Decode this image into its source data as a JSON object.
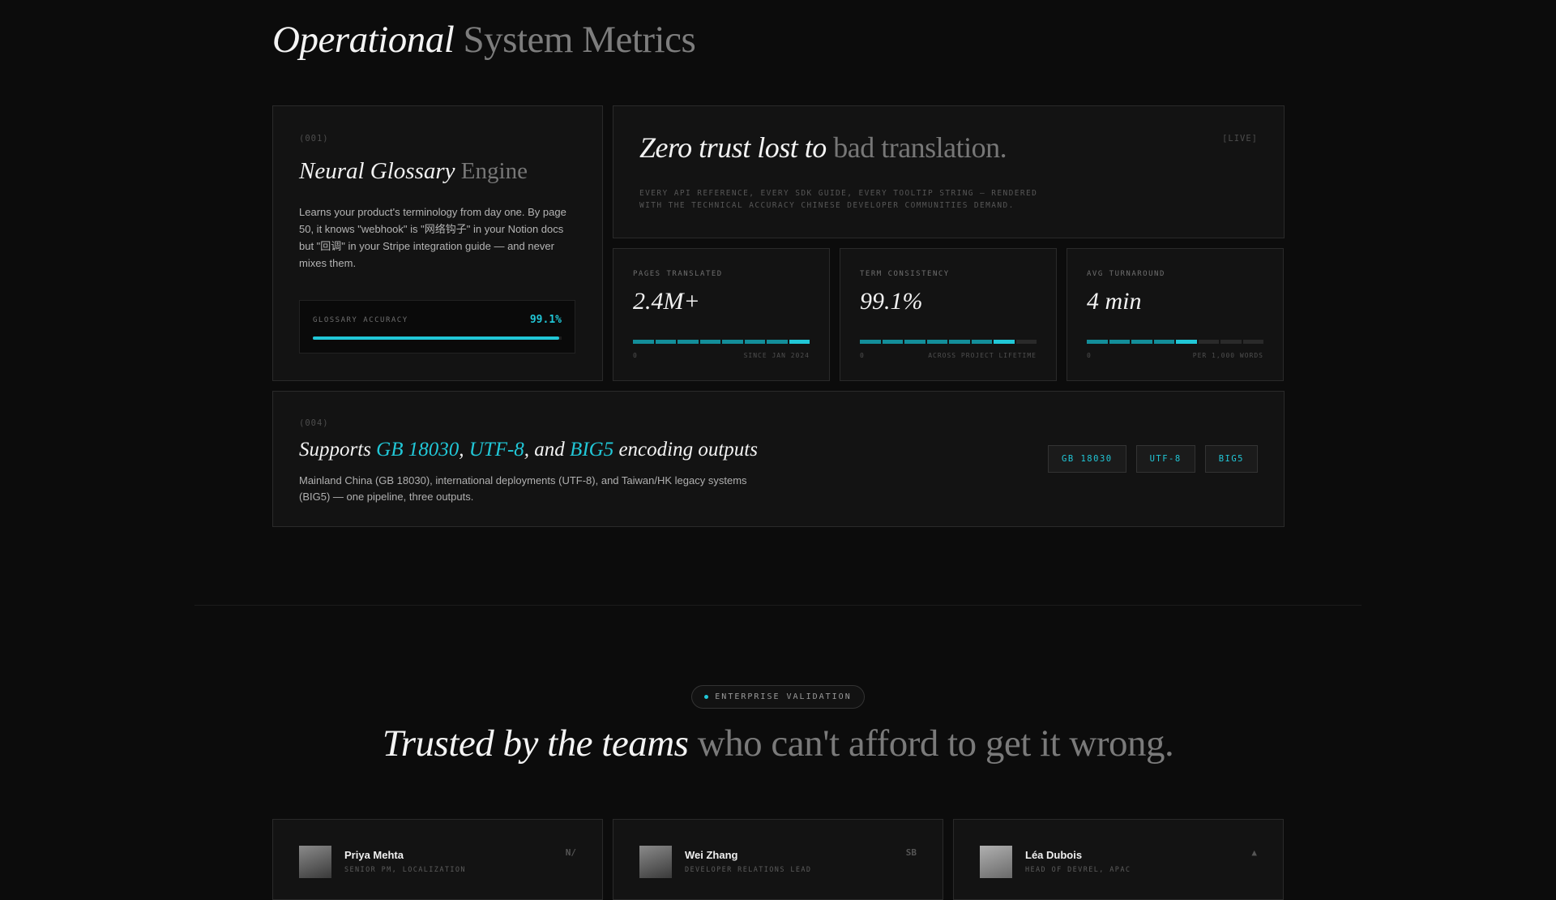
{
  "header": {
    "title_em": "Operational",
    "title_rest": "System Metrics"
  },
  "glossary": {
    "index": "(001)",
    "title_em": "Neural Glossary",
    "title_rest": "Engine",
    "description": "Learns your product's terminology from day one. By page 50, it knows \"webhook\" is \"网络钩子\" in your Notion docs but \"回调\" in your Stripe integration guide — and never mixes them.",
    "accuracy_label": "GLOSSARY ACCURACY",
    "accuracy_value": "99.1%",
    "accuracy_fraction": 0.991
  },
  "hero": {
    "title_em": "Zero trust lost to",
    "title_rest": "bad translation.",
    "live_tag": "[LIVE]",
    "subtitle": "EVERY API REFERENCE, EVERY SDK GUIDE, EVERY TOOLTIP STRING — RENDERED WITH THE TECHNICAL ACCURACY CHINESE DEVELOPER COMMUNITIES DEMAND."
  },
  "stats": [
    {
      "label": "PAGES TRANSLATED",
      "value": "2.4M+",
      "min_label": "0",
      "max_label": "SINCE JAN 2024",
      "segments_on": 8,
      "segments_total": 8
    },
    {
      "label": "TERM CONSISTENCY",
      "value": "99.1%",
      "min_label": "0",
      "max_label": "ACROSS PROJECT LIFETIME",
      "segments_on": 7,
      "segments_total": 8
    },
    {
      "label": "AVG TURNAROUND",
      "value": "4 min",
      "min_label": "0",
      "max_label": "PER 1,000 WORDS",
      "segments_on": 5,
      "segments_total": 8
    }
  ],
  "encoding": {
    "index": "(004)",
    "title_prefix": "Supports",
    "enc_1": "GB 18030",
    "sep_1": ",",
    "enc_2": "UTF-8",
    "sep_2": ", and",
    "enc_3": "BIG5",
    "title_suffix": "encoding outputs",
    "description": "Mainland China (GB 18030), international deployments (UTF-8), and Taiwan/HK legacy systems (BIG5) — one pipeline, three outputs.",
    "buttons": [
      "GB 18030",
      "UTF-8",
      "BIG5"
    ]
  },
  "testimonials": {
    "badge": "ENTERPRISE VALIDATION",
    "title_em": "Trusted by the teams",
    "title_rest": "who can't afford to get it wrong.",
    "people": [
      {
        "name": "Priya Mehta",
        "role": "SENIOR PM, LOCALIZATION",
        "mark": "N/"
      },
      {
        "name": "Wei Zhang",
        "role": "DEVELOPER RELATIONS LEAD",
        "mark": "SB"
      },
      {
        "name": "Léa Dubois",
        "role": "HEAD OF DEVREL, APAC",
        "mark": "▲"
      }
    ]
  },
  "colors": {
    "background": "#0c0c0c",
    "card": "#131313",
    "accent": "#21c7d7",
    "accent_dim": "#138e9a"
  }
}
